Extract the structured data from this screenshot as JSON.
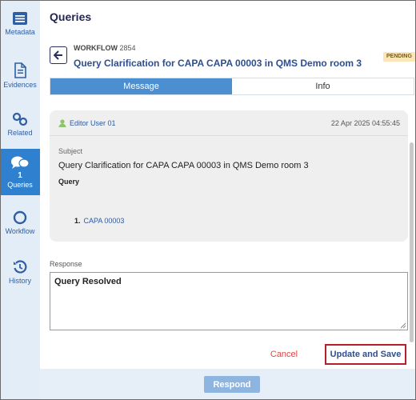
{
  "sidebar": {
    "metadata": "Metadata",
    "evidences": "Evidences",
    "related": "Related",
    "queries_count": "1",
    "queries": "Queries",
    "workflow": "Workflow",
    "history": "History"
  },
  "header": {
    "title": "Queries",
    "workflow_label": "WORKFLOW",
    "workflow_id": "2854",
    "workflow_title": "Query Clarification for CAPA CAPA 00003 in QMS Demo room 3",
    "status": "PENDING"
  },
  "tabs": {
    "message": "Message",
    "info": "Info"
  },
  "query": {
    "user": "Editor User 01",
    "timestamp": "22 Apr 2025 04:55:45",
    "subject_label": "Subject",
    "subject": "Query Clarification for CAPA CAPA 00003 in QMS Demo room 3",
    "query_label": "Query",
    "item_number": "1.",
    "item_text": "CAPA 00003"
  },
  "response": {
    "label": "Response",
    "value": "Query Resolved"
  },
  "actions": {
    "cancel": "Cancel",
    "update_save": "Update and Save",
    "respond": "Respond"
  },
  "colors": {
    "accent": "#2f80cf",
    "tab_active": "#4c8fd0",
    "cancel": "#e04444",
    "highlight_border": "#b5202a",
    "badge_bg": "#fbe6b8"
  },
  "icons": {
    "metadata": "list-card-icon",
    "evidences": "document-icon",
    "related": "link-icon",
    "queries": "chat-bubbles-icon",
    "workflow": "circle-icon",
    "history": "history-icon",
    "back": "arrow-left-icon",
    "user": "user-icon"
  }
}
